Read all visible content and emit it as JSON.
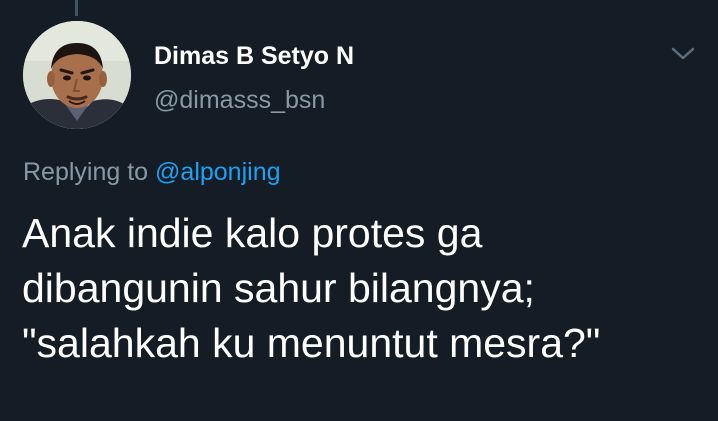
{
  "author": {
    "display_name": "Dimas B Setyo N",
    "handle": "@dimasss_bsn",
    "avatar_icon": "user-avatar-photo"
  },
  "menu": {
    "icon": "chevron-down-icon"
  },
  "reply": {
    "prefix": "Replying to",
    "mention": "@alponjing"
  },
  "tweet": {
    "lines": [
      "Anak indie kalo protes ga",
      "dibangunin sahur bilangnya;",
      "\"salahkah ku menuntut mesra?\""
    ]
  },
  "colors": {
    "background": "#141d26",
    "primary_text": "#ffffff",
    "secondary_text": "#8899a6",
    "link": "#1da1f2"
  }
}
